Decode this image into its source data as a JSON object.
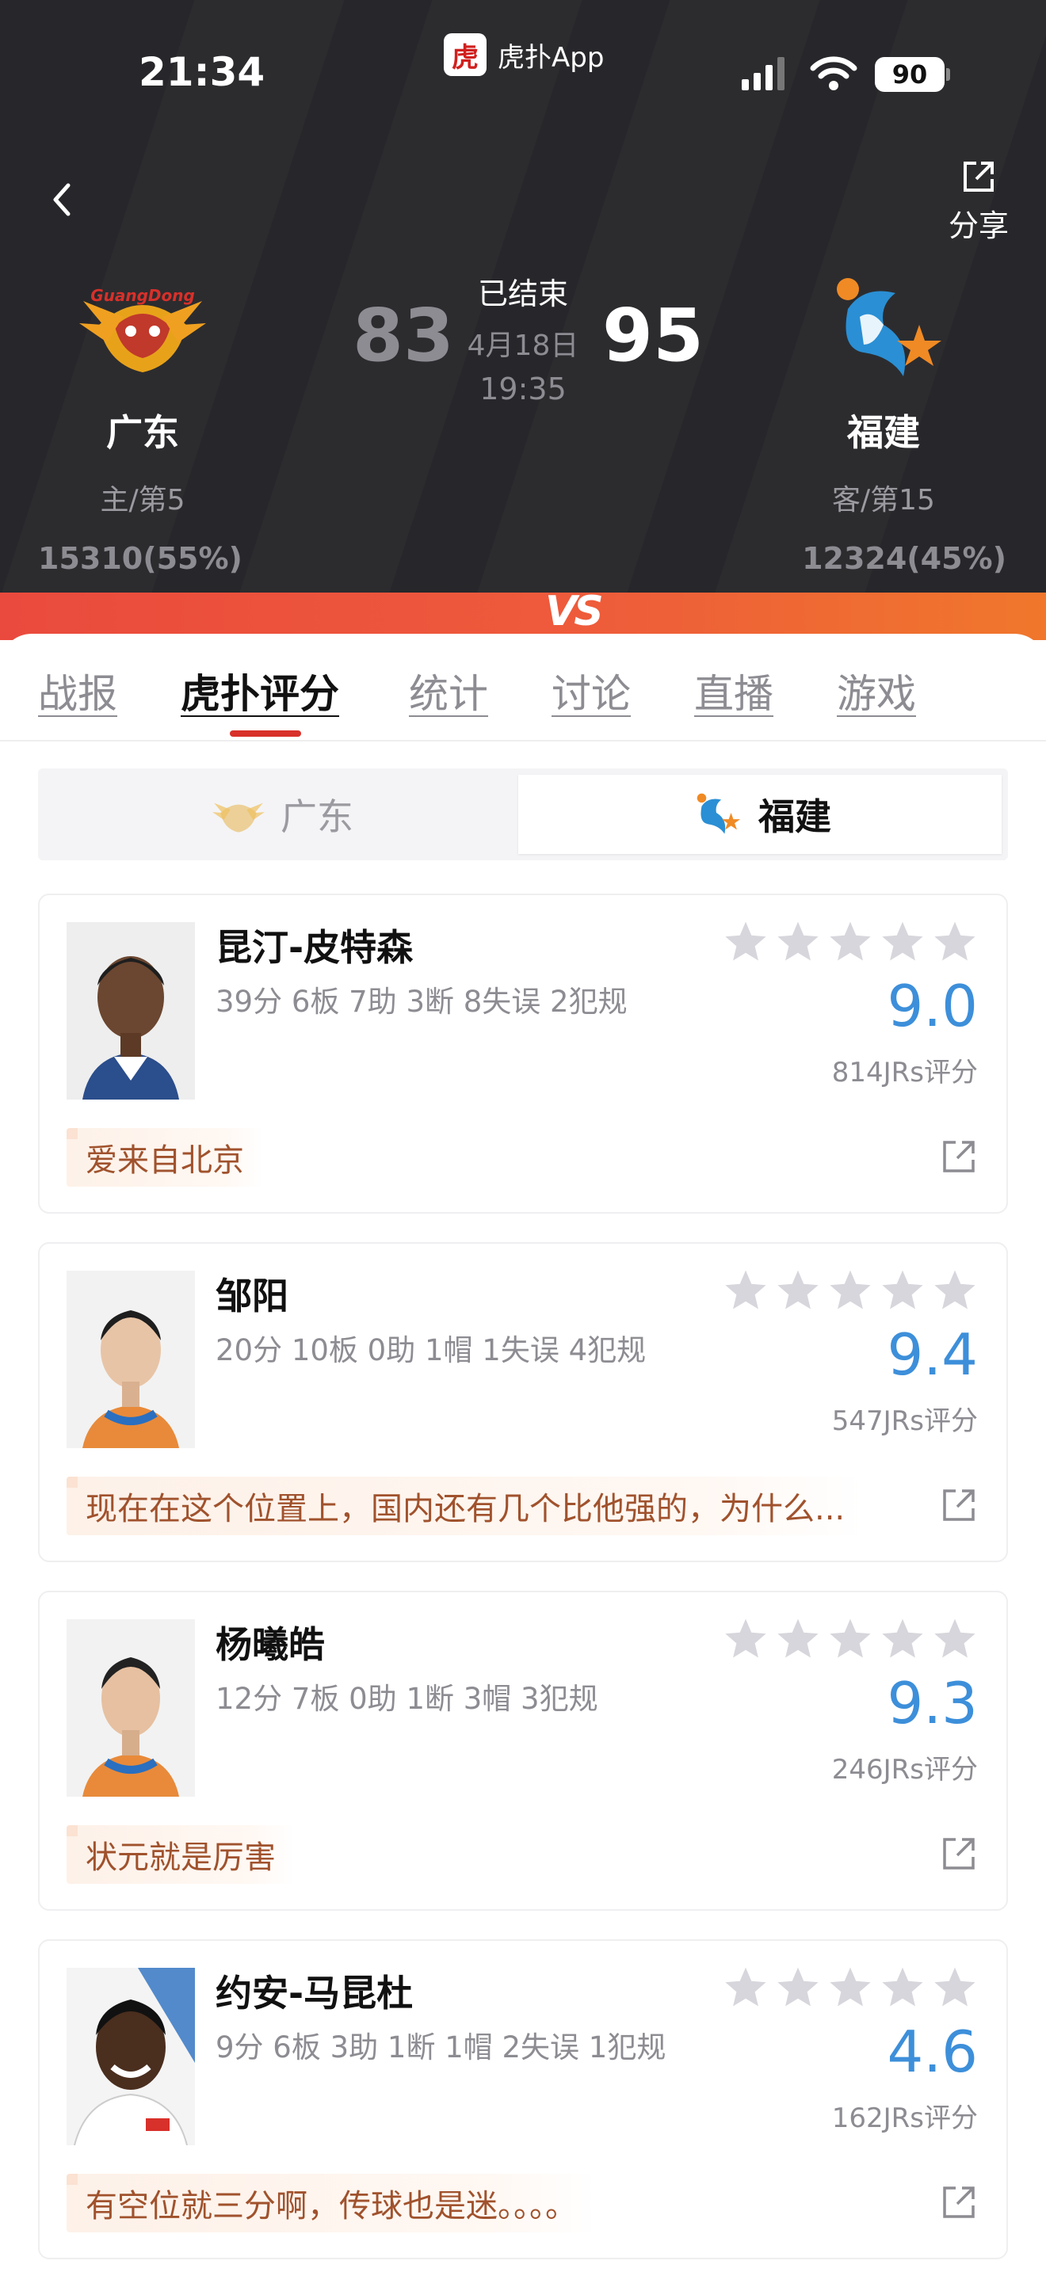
{
  "status_bar": {
    "time": "21:34",
    "app_name": "虎扑App",
    "app_logo_char": "虎",
    "battery": "90"
  },
  "header": {
    "share_label": "分享",
    "game_status": "已结束",
    "date": "4月18日",
    "time": "19:35",
    "home": {
      "name": "广东",
      "rank": "主/第5",
      "score": "83",
      "support": "15310(55%)",
      "logo_text": "GuangDong"
    },
    "away": {
      "name": "福建",
      "rank": "客/第15",
      "score": "95",
      "support": "12324(45%)"
    },
    "vs": "VS"
  },
  "tabs": [
    {
      "label": "战报",
      "active": false
    },
    {
      "label": "虎扑评分",
      "active": true
    },
    {
      "label": "统计",
      "active": false
    },
    {
      "label": "讨论",
      "active": false
    },
    {
      "label": "直播",
      "active": false
    },
    {
      "label": "游戏",
      "active": false
    }
  ],
  "team_toggle": {
    "left": "广东",
    "right": "福建",
    "selected": "福建"
  },
  "players": [
    {
      "name": "昆汀-皮特森",
      "stats": "39分 6板 7助 3断 8失误 2犯规",
      "rating": "9.0",
      "count": "814JRs评分",
      "comment": "爱来自北京",
      "stars": 0
    },
    {
      "name": "邹阳",
      "stats": "20分 10板 0助 1帽 1失误 4犯规",
      "rating": "9.4",
      "count": "547JRs评分",
      "comment": "现在在这个位置上，国内还有几个比他强的，为什么...",
      "stars": 0
    },
    {
      "name": "杨曦皓",
      "stats": "12分 7板 0助 1断 3帽 3犯规",
      "rating": "9.3",
      "count": "246JRs评分",
      "comment": "状元就是厉害",
      "stars": 0
    },
    {
      "name": "约安-马昆杜",
      "stats": "9分 6板 3助 1断 1帽 2失误 1犯规",
      "rating": "4.6",
      "count": "162JRs评分",
      "comment": "有空位就三分啊，传球也是迷。。。。",
      "stars": 0
    }
  ],
  "colors": {
    "header_bg": "#27272b",
    "accent_red": "#d8302a",
    "rating_blue": "#3d8fda",
    "comment_text": "#a0522d"
  }
}
